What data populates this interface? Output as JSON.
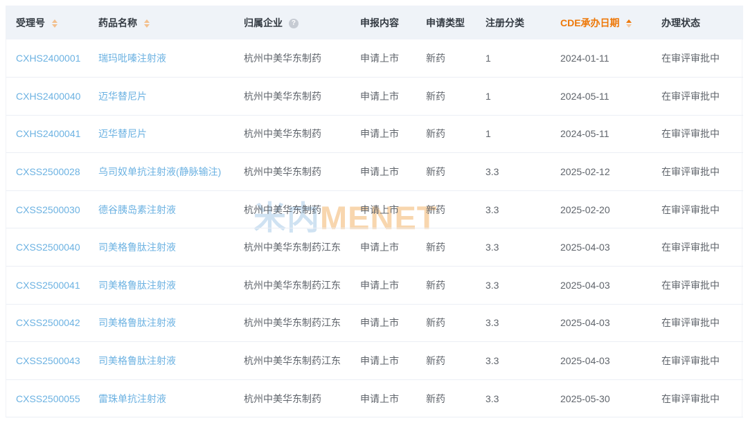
{
  "watermark": {
    "cn": "米内",
    "en": "MENET"
  },
  "icons": {
    "help": "?"
  },
  "colors": {
    "accent_orange": "#ee7808",
    "link_blue": "#6cb2e2",
    "header_bg": "#eff3f8",
    "row_divider": "#ebeef5",
    "watermark_blue": "#cfe2f2",
    "watermark_orange": "#f8d6ae"
  },
  "table": {
    "columns": [
      {
        "key": "acceptance_no",
        "label": "受理号",
        "sortable": true
      },
      {
        "key": "drug_name",
        "label": "药品名称",
        "sortable": true
      },
      {
        "key": "company",
        "label": "归属企业",
        "help": true
      },
      {
        "key": "declared_content",
        "label": "申报内容"
      },
      {
        "key": "application_type",
        "label": "申请类型"
      },
      {
        "key": "registration_class",
        "label": "注册分类"
      },
      {
        "key": "cde_date",
        "label": "CDE承办日期",
        "sortable": true,
        "sort_active": "asc"
      },
      {
        "key": "status",
        "label": "办理状态"
      }
    ],
    "rows": [
      {
        "acceptance_no": "CXHS2400001",
        "drug_name": "瑞玛吡嗪注射液",
        "company": "杭州中美华东制药",
        "declared_content": "申请上市",
        "application_type": "新药",
        "registration_class": "1",
        "cde_date": "2024-01-11",
        "status": "在审评审批中"
      },
      {
        "acceptance_no": "CXHS2400040",
        "drug_name": "迈华替尼片",
        "company": "杭州中美华东制药",
        "declared_content": "申请上市",
        "application_type": "新药",
        "registration_class": "1",
        "cde_date": "2024-05-11",
        "status": "在审评审批中"
      },
      {
        "acceptance_no": "CXHS2400041",
        "drug_name": "迈华替尼片",
        "company": "杭州中美华东制药",
        "declared_content": "申请上市",
        "application_type": "新药",
        "registration_class": "1",
        "cde_date": "2024-05-11",
        "status": "在审评审批中"
      },
      {
        "acceptance_no": "CXSS2500028",
        "drug_name": "乌司奴单抗注射液(静脉输注)",
        "company": "杭州中美华东制药",
        "declared_content": "申请上市",
        "application_type": "新药",
        "registration_class": "3.3",
        "cde_date": "2025-02-12",
        "status": "在审评审批中"
      },
      {
        "acceptance_no": "CXSS2500030",
        "drug_name": "德谷胰岛素注射液",
        "company": "杭州中美华东制药",
        "declared_content": "申请上市",
        "application_type": "新药",
        "registration_class": "3.3",
        "cde_date": "2025-02-20",
        "status": "在审评审批中"
      },
      {
        "acceptance_no": "CXSS2500040",
        "drug_name": "司美格鲁肽注射液",
        "company": "杭州中美华东制药江东",
        "declared_content": "申请上市",
        "application_type": "新药",
        "registration_class": "3.3",
        "cde_date": "2025-04-03",
        "status": "在审评审批中"
      },
      {
        "acceptance_no": "CXSS2500041",
        "drug_name": "司美格鲁肽注射液",
        "company": "杭州中美华东制药江东",
        "declared_content": "申请上市",
        "application_type": "新药",
        "registration_class": "3.3",
        "cde_date": "2025-04-03",
        "status": "在审评审批中"
      },
      {
        "acceptance_no": "CXSS2500042",
        "drug_name": "司美格鲁肽注射液",
        "company": "杭州中美华东制药江东",
        "declared_content": "申请上市",
        "application_type": "新药",
        "registration_class": "3.3",
        "cde_date": "2025-04-03",
        "status": "在审评审批中"
      },
      {
        "acceptance_no": "CXSS2500043",
        "drug_name": "司美格鲁肽注射液",
        "company": "杭州中美华东制药江东",
        "declared_content": "申请上市",
        "application_type": "新药",
        "registration_class": "3.3",
        "cde_date": "2025-04-03",
        "status": "在审评审批中"
      },
      {
        "acceptance_no": "CXSS2500055",
        "drug_name": "雷珠单抗注射液",
        "company": "杭州中美华东制药",
        "declared_content": "申请上市",
        "application_type": "新药",
        "registration_class": "3.3",
        "cde_date": "2025-05-30",
        "status": "在审评审批中"
      }
    ]
  }
}
